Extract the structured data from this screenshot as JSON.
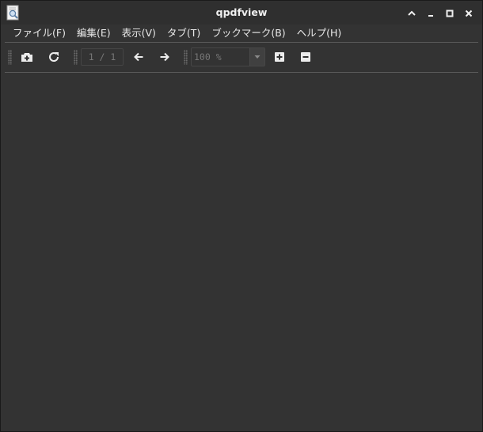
{
  "window": {
    "title": "qpdfview"
  },
  "menubar": {
    "items": [
      {
        "label": "ファイル(F)"
      },
      {
        "label": "編集(E)"
      },
      {
        "label": "表示(V)"
      },
      {
        "label": "タブ(T)"
      },
      {
        "label": "ブックマーク(B)"
      },
      {
        "label": "ヘルプ(H)"
      }
    ]
  },
  "toolbar": {
    "page_indicator": "1 / 1",
    "zoom_value": "100 %"
  },
  "icons": {
    "app": "qpdfview-document-magnifier-icon",
    "open": "open-tab-plus-icon",
    "refresh": "refresh-icon",
    "previous": "arrow-left-icon",
    "next": "arrow-right-icon",
    "zoom_in": "plus-square-icon",
    "zoom_out": "minus-square-icon"
  },
  "colors": {
    "background": "#333333",
    "titlebar": "#2f2f2f",
    "text": "#e6e6e6",
    "disabled_text": "#777777",
    "separator": "#5a5a5a"
  }
}
